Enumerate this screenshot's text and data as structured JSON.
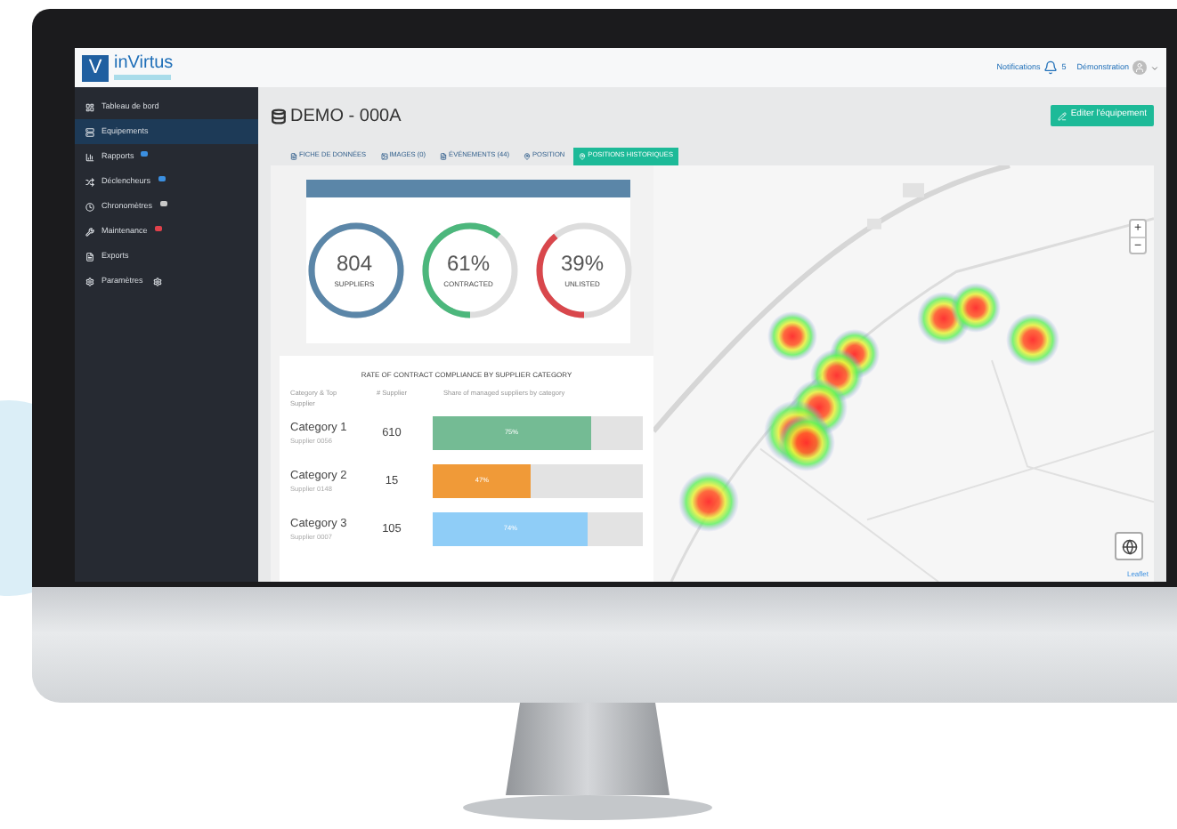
{
  "top_bar": {
    "logo": {
      "mark": "V",
      "name": "inVirtus"
    },
    "notifications_label": "Notifications",
    "notifications_count": "5",
    "user": "Démonstration"
  },
  "sidebar": {
    "items": [
      {
        "label": "Tableau de bord",
        "selected": false
      },
      {
        "label": "Equipements",
        "selected": true
      },
      {
        "label": "Rapports",
        "selected": false,
        "color": "#3b8fe0"
      },
      {
        "label": "Déclencheurs",
        "selected": false,
        "color": "#3b8fe0"
      },
      {
        "label": "Chronomètres",
        "selected": false,
        "color": "#c8c8c8"
      },
      {
        "label": "Maintenance",
        "selected": false,
        "color": "#e0414b"
      },
      {
        "label": "Exports",
        "selected": false
      },
      {
        "label": "Paramètres",
        "selected": false,
        "trailing_icon": true
      }
    ]
  },
  "header": {
    "title": "DEMO - 000A",
    "edit_button": "Editer l'équipement"
  },
  "tabs": [
    {
      "label": "FICHE DE DONNÉES",
      "selected": false
    },
    {
      "label": "IMAGES (0)",
      "selected": false
    },
    {
      "label": "ÉVÉNEMENTS (44)",
      "selected": false
    },
    {
      "label": "POSITION",
      "selected": false
    },
    {
      "label": "POSITIONS HISTORIQUES",
      "selected": true
    }
  ],
  "donuts": [
    {
      "value": "804",
      "label": "SUPPLIERS",
      "level": 1,
      "color": "#5b86a8"
    },
    {
      "value": "61%",
      "label": "CONTRACTED",
      "level": 0.61,
      "color": "#4cb77c"
    },
    {
      "value": "39%",
      "label": "UNLISTED",
      "level": 0.39,
      "color": "#d9474c"
    }
  ],
  "compliance": {
    "title": "RATE OF CONTRACT COMPLIANCE BY SUPPLIER CATEGORY",
    "columns": [
      "Category & Top Supplier",
      "# Supplier",
      "Share of managed suppliers by category"
    ],
    "rows": [
      {
        "category": "Category 1",
        "supplier": "Supplier 0056",
        "count": "610",
        "share": "75%",
        "level": 0.75,
        "color": "#74bb94"
      },
      {
        "category": "Category 2",
        "supplier": "Supplier 0148",
        "count": "15",
        "share": "47%",
        "level": 0.47,
        "color": "#f09a38"
      },
      {
        "category": "Category 3",
        "supplier": "Supplier 0007",
        "count": "105",
        "share": "74%",
        "level": 0.74,
        "color": "#8fcdf7"
      }
    ]
  },
  "map": {
    "zoom_in": "+",
    "zoom_out": "−",
    "attribution": "Leaflet"
  }
}
